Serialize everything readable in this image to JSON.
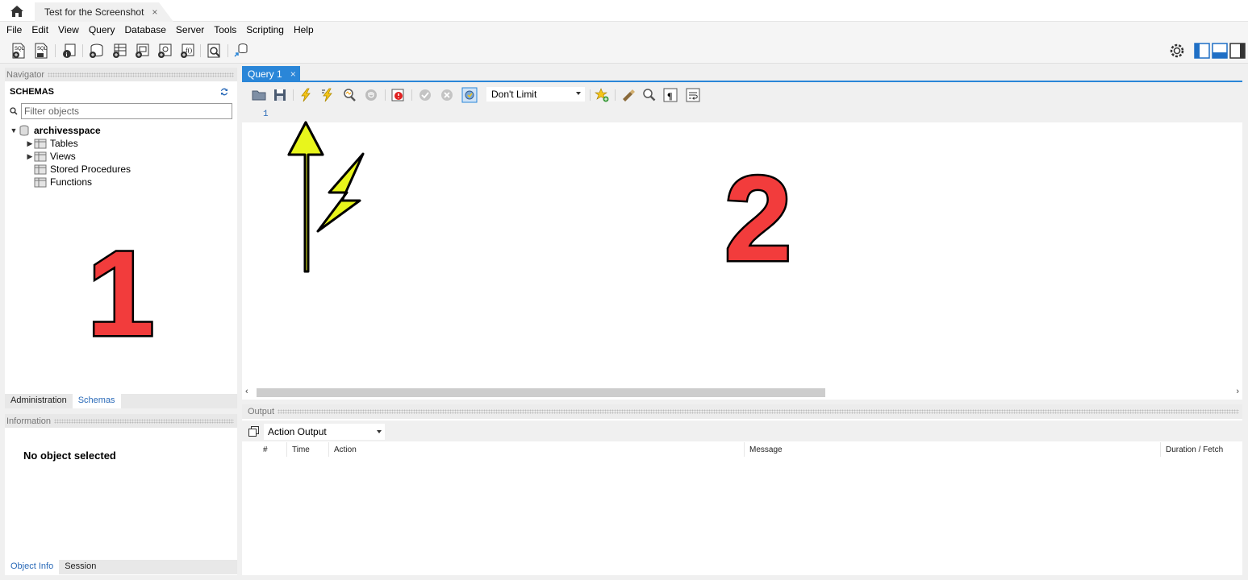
{
  "tabs": {
    "home_icon": "home-icon",
    "connection_tab_label": "Test for the Screenshot",
    "close_glyph": "×"
  },
  "menu": [
    "File",
    "Edit",
    "View",
    "Query",
    "Database",
    "Server",
    "Tools",
    "Scripting",
    "Help"
  ],
  "navigator": {
    "header": "Navigator",
    "schemas_title": "SCHEMAS",
    "filter_placeholder": "Filter objects",
    "schema_name": "archivesspace",
    "items": [
      "Tables",
      "Views",
      "Stored Procedures",
      "Functions"
    ],
    "bottom_tabs": [
      "Administration",
      "Schemas"
    ]
  },
  "information": {
    "header": "Information",
    "message": "No object selected",
    "bottom_tabs": [
      "Object Info",
      "Session"
    ]
  },
  "editor": {
    "query_tab_label": "Query 1",
    "close_glyph": "×",
    "limit_value": "Don't Limit",
    "line_number": "1"
  },
  "output": {
    "header": "Output",
    "selector_value": "Action Output",
    "columns": [
      "#",
      "Time",
      "Action",
      "Message",
      "Duration / Fetch"
    ]
  },
  "annotations": {
    "number_one": "1",
    "number_two": "2"
  },
  "colors": {
    "accent_blue": "#2a86d8",
    "annotation_red": "#f23c3c",
    "annotation_yellow": "#e8f51c"
  }
}
